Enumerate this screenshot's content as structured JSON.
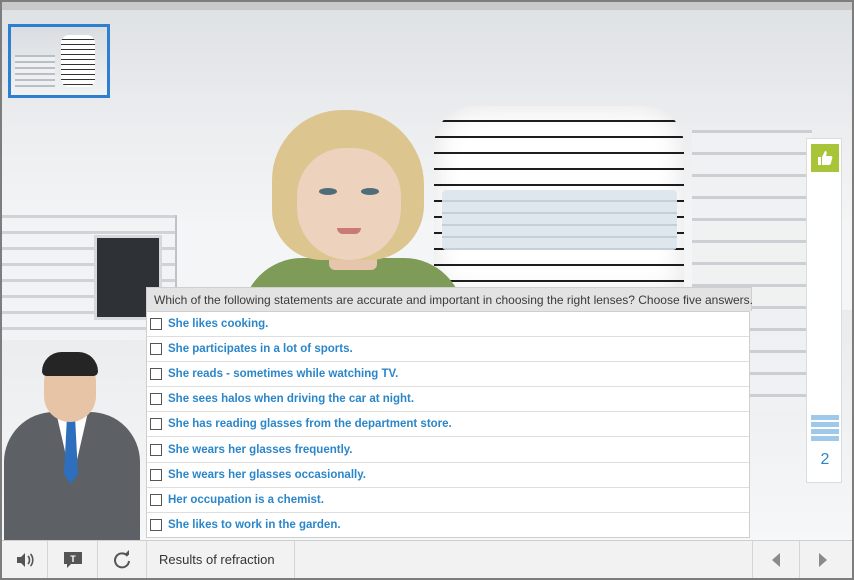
{
  "question": {
    "text": "Which of the following statements are accurate and important in choosing the right lenses? Choose five answers."
  },
  "answers": [
    {
      "label": "She likes cooking.",
      "checked": false
    },
    {
      "label": "She participates in a lot of sports.",
      "checked": false
    },
    {
      "label": "She reads - sometimes while watching TV.",
      "checked": false
    },
    {
      "label": "She sees halos when driving the car at night.",
      "checked": false
    },
    {
      "label": "She has reading glasses from the department store.",
      "checked": false
    },
    {
      "label": "She wears her glasses frequently.",
      "checked": false
    },
    {
      "label": "She wears her glasses occasionally.",
      "checked": false
    },
    {
      "label": "Her occupation is a chemist.",
      "checked": false
    },
    {
      "label": "She likes to work in the garden.",
      "checked": false
    }
  ],
  "progress": {
    "count": "2",
    "fill_fraction": 0.1,
    "icon": "thumbs-up-icon",
    "accent": "#a8c439",
    "bar_color": "#9ec9ea"
  },
  "toolbar": {
    "status_text": "Results of refraction",
    "icons": [
      "speaker-icon",
      "transcript-icon",
      "replay-icon",
      "previous-arrow-icon",
      "next-arrow-icon"
    ]
  },
  "colors": {
    "answer_text": "#2b86c9",
    "thumbnail_border": "#2f7fd0"
  }
}
